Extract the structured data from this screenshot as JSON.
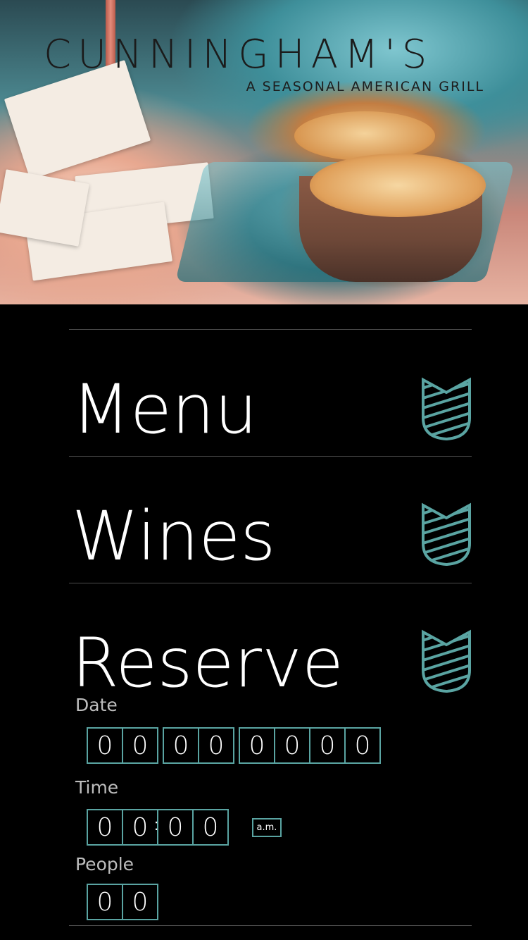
{
  "brand": {
    "name": "CUNNINGHAM'S",
    "tagline": "A SEASONAL AMERICAN GRILL",
    "accent_color": "#5aa4a2"
  },
  "nav": [
    {
      "label": "Menu",
      "icon": "crest-icon"
    },
    {
      "label": "Wines",
      "icon": "crest-icon"
    },
    {
      "label": "Reserve",
      "icon": "crest-icon"
    }
  ],
  "reserve": {
    "date": {
      "label": "Date",
      "digits": [
        "0",
        "0",
        "0",
        "0",
        "0",
        "0",
        "0",
        "0"
      ]
    },
    "time": {
      "label": "Time",
      "digits": [
        "0",
        "0",
        "0",
        "0"
      ],
      "separator": ":",
      "meridiem": "a.m."
    },
    "people": {
      "label": "People",
      "digits": [
        "0",
        "0"
      ]
    }
  }
}
